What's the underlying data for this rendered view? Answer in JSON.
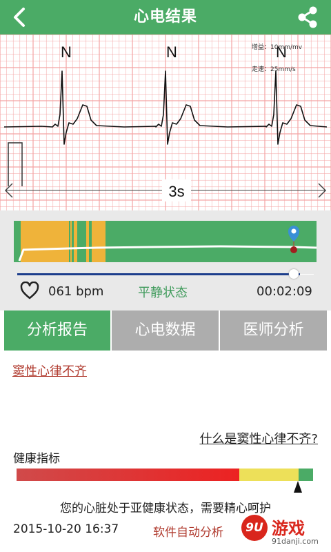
{
  "header": {
    "title": "心电结果",
    "back_icon": "chevron-left-icon",
    "share_icon": "share-icon",
    "color": "#4bab66"
  },
  "ecg": {
    "beat_labels": [
      "N",
      "N",
      "N"
    ],
    "gain_text": "增益：10mm/mv",
    "speed_text": "走速：25mm/s",
    "span_label": "3s",
    "grid_color": "#f4a3a3",
    "trace_color": "#111111"
  },
  "summary": {
    "heart_icon": "heart-outline-icon",
    "bpm": "061 bpm",
    "state": "平静状态",
    "duration": "00:02:09",
    "position_fraction": 0.96
  },
  "tabs": [
    {
      "label": "分析报告",
      "active": true
    },
    {
      "label": "心电数据",
      "active": false
    },
    {
      "label": "医师分析",
      "active": false
    }
  ],
  "report": {
    "diagnosis": "窦性心律不齐",
    "what_is_link": "什么是窦性心律不齐?",
    "health_label": "健康指标",
    "health_colors": [
      "#d63b3b",
      "#ede059",
      "#4bab66"
    ],
    "advice": "您的心脏处于亚健康状态，需要精心呵护",
    "datetime": "2015-10-20 16:37",
    "source": "软件自动分析"
  },
  "watermark": {
    "icon_text": "9U",
    "brand": "游戏",
    "url": "91danji.com"
  }
}
